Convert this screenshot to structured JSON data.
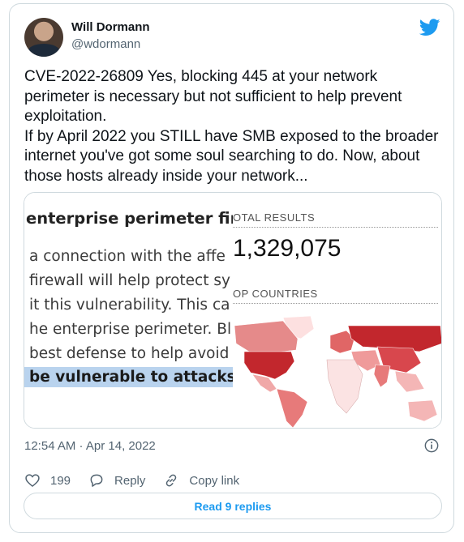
{
  "author": {
    "name": "Will Dormann",
    "handle": "@wdormann"
  },
  "tweet": {
    "lines": [
      "CVE-2022-26809 Yes, blocking 445 at your network perimeter is necessary but not sufficient to help prevent exploitation.",
      "If by April 2022 you STILL have SMB exposed to the broader internet you've got some soul searching to do. Now, about those hosts already inside your network..."
    ]
  },
  "media": {
    "document": {
      "heading": "enterprise perimeter firew",
      "lines": [
        "a connection with the affe",
        "firewall will help protect sy",
        "it this vulnerability. This ca",
        "he enterprise perimeter. Bl",
        "best defense to help avoid"
      ],
      "highlight": "be vulnerable to attacks f"
    },
    "stats": {
      "total_label": "OTAL RESULTS",
      "total_value": "1,329,075",
      "countries_label": "OP COUNTRIES"
    }
  },
  "meta": {
    "timestamp": "12:54 AM · Apr 14, 2022"
  },
  "actions": {
    "likes": "199",
    "reply": "Reply",
    "copy_link": "Copy link"
  },
  "footer": {
    "read_replies": "Read 9 replies"
  },
  "colors": {
    "accent": "#1d9bf0",
    "map_strong": "#c2272d",
    "map_light": "#f4b6b6"
  },
  "icons": [
    "twitter-bird-icon",
    "info-icon",
    "heart-icon",
    "reply-bubble-icon",
    "link-icon"
  ]
}
